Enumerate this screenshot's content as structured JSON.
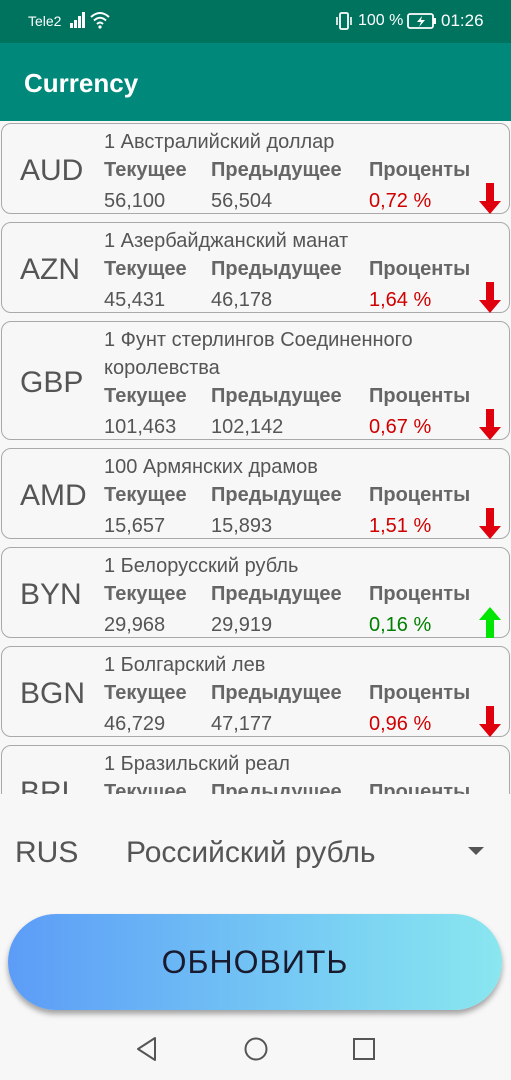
{
  "status": {
    "carrier": "Tele2",
    "battery": "100 %",
    "time": "01:26"
  },
  "app": {
    "title": "Currency"
  },
  "labels": {
    "current": "Текущее",
    "previous": "Предыдущее",
    "percent": "Проценты"
  },
  "rates": [
    {
      "code": "AUD",
      "name": "1 Австралийский доллар",
      "current": "56,100",
      "previous": "56,504",
      "percent": "0,72 %",
      "trend": "down"
    },
    {
      "code": "AZN",
      "name": "1 Азербайджанский манат",
      "current": "45,431",
      "previous": "46,178",
      "percent": "1,64 %",
      "trend": "down"
    },
    {
      "code": "GBP",
      "name": "1 Фунт стерлингов Соединенного королевства",
      "current": "101,463",
      "previous": "102,142",
      "percent": "0,67 %",
      "trend": "down"
    },
    {
      "code": "AMD",
      "name": "100 Армянских драмов",
      "current": "15,657",
      "previous": "15,893",
      "percent": "1,51 %",
      "trend": "down"
    },
    {
      "code": "BYN",
      "name": "1 Белорусский рубль",
      "current": "29,968",
      "previous": "29,919",
      "percent": "0,16 %",
      "trend": "up"
    },
    {
      "code": "BGN",
      "name": "1 Болгарский лев",
      "current": "46,729",
      "previous": "47,177",
      "percent": "0,96 %",
      "trend": "down"
    },
    {
      "code": "BRL",
      "name": "1 Бразильский реал",
      "current": "",
      "previous": "",
      "percent": "",
      "trend": "down"
    }
  ],
  "base": {
    "code": "RUS",
    "name": "Российский рубль"
  },
  "actions": {
    "refresh": "ОБНОВИТЬ"
  },
  "colors": {
    "appbar": "#00897b",
    "statusbar": "#00735f",
    "down": "#e0000d",
    "up": "#00e600",
    "pct_down": "#d00000",
    "pct_up": "#008000"
  }
}
